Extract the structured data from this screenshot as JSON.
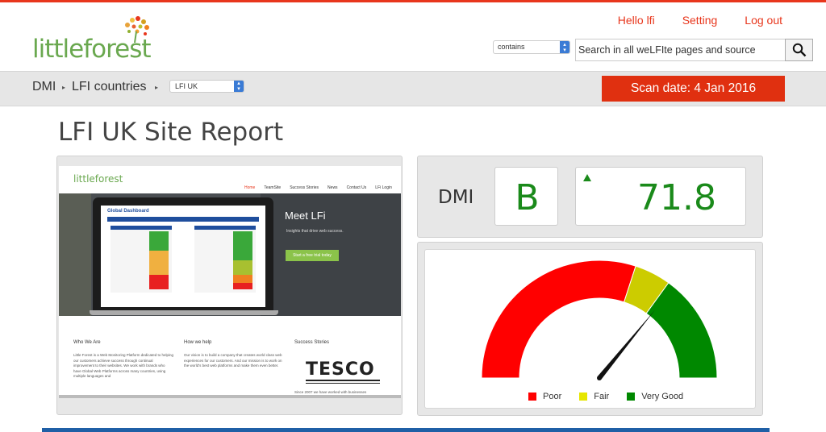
{
  "header": {
    "logo_text": "littleforest",
    "links": [
      "Hello lfi",
      "Setting",
      "Log out"
    ],
    "search_mode": "contains",
    "search_placeholder": "Search in all weLFIte pages and source"
  },
  "breadcrumb": {
    "items": [
      "DMI",
      "LFI countries"
    ],
    "country_select": "LFI UK",
    "scan_date": "Scan date: 4 Jan 2016"
  },
  "page_title": "LFI UK Site Report",
  "preview": {
    "logo": "littleforest",
    "nav": [
      "Home",
      "TeamSite",
      "Success Stories",
      "News",
      "Contact Us",
      "LFi Login"
    ],
    "dashboard_title": "Global Dashboard",
    "hero_title": "Meet LFi",
    "hero_sub": "Insights that drive web success.",
    "hero_button": "Start a free trial today",
    "columns": [
      {
        "title": "Who We Are",
        "text": "Little Forest is a Web Monitoring Platform dedicated to helping our customers achieve success through continual improvement to their websites. We work with brands who have Global Web Platforms across many countries, using multiple languages and"
      },
      {
        "title": "How we help",
        "text": "Our vision is to build a company that creates world class web experiences for our customers. And our mission is to work on the world's best web platforms and make them even better."
      },
      {
        "title": "Success Stories",
        "text": "Since 2007 we have worked with businesses"
      }
    ],
    "tesco": "TESCO"
  },
  "dmi": {
    "label": "DMI",
    "grade": "B",
    "score": "71.8",
    "trend": "up"
  },
  "gauge": {
    "value": 71.8,
    "min": 0,
    "max": 100,
    "bands": [
      {
        "label": "Poor",
        "from": 0,
        "to": 60,
        "color": "#ff0000"
      },
      {
        "label": "Fair",
        "from": 60,
        "to": 70,
        "color": "#cccc00"
      },
      {
        "label": "Very Good",
        "from": 70,
        "to": 100,
        "color": "#008800"
      }
    ],
    "legend_colors": {
      "poor": "#ff0000",
      "fair": "#e6e600",
      "very_good": "#008800"
    }
  },
  "colors": {
    "accent": "#e8361c",
    "brand_green": "#6aa84f",
    "grade_green": "#1a8a1a",
    "scan_bg": "#e03010"
  }
}
